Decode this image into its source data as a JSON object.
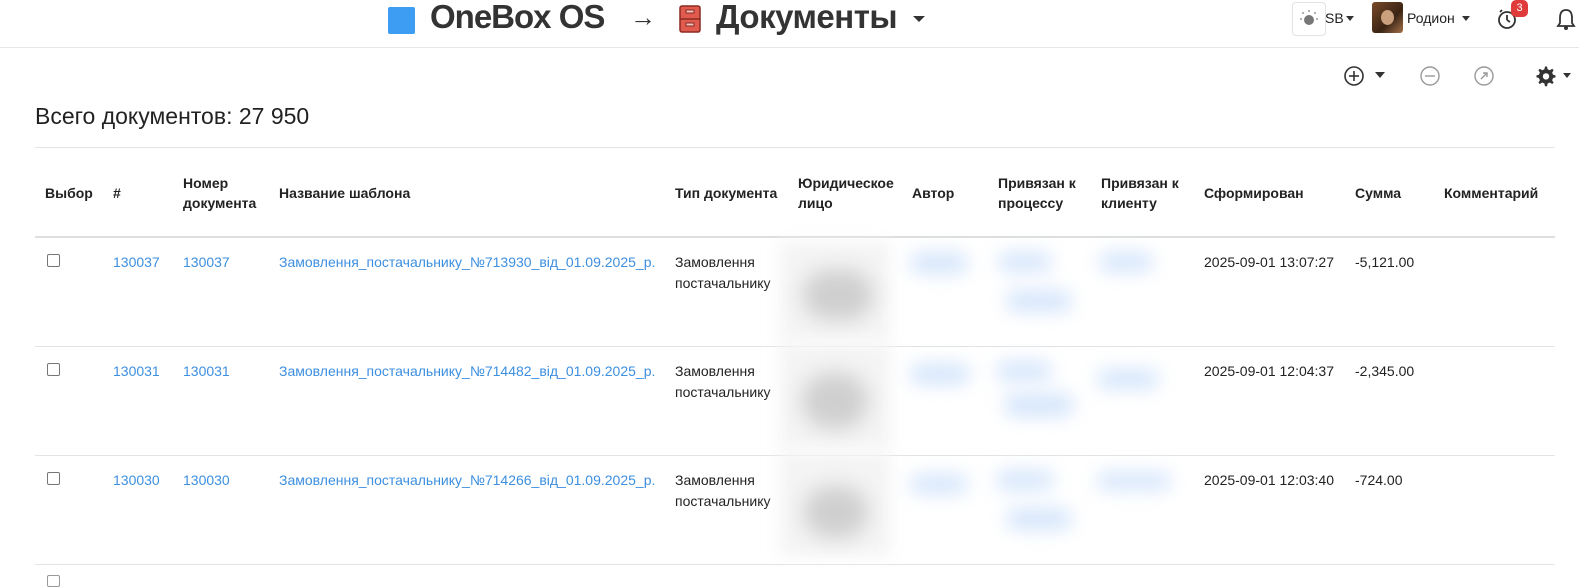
{
  "header": {
    "brand": "OneBox OS",
    "arrow": "→",
    "section": "Документы",
    "account": "SB",
    "user": "Родион",
    "notifications": "3"
  },
  "toolbar": {
    "icons": [
      "add-circle-icon",
      "minus-circle-icon",
      "arrow-circle-icon",
      "gear-icon"
    ]
  },
  "summary": {
    "label": "Всего документов: 27 950"
  },
  "table": {
    "columns": [
      "Выбор",
      "#",
      "Номер документа",
      "Название шаблона",
      "Тип документа",
      "Юридическое лицо",
      "Автор",
      "Привязан к процессу",
      "Привязан к клиенту",
      "Сформирован",
      "Сумма",
      "Комментарий"
    ],
    "rows": [
      {
        "id": "130037",
        "number": "130037",
        "template": "Замовлення_постачальнику_№713930_від_01.09.2025_р.",
        "type": "Замовлення постачальнику",
        "created": "2025-09-01 13:07:27",
        "sum": "-5,121.00",
        "comment": ""
      },
      {
        "id": "130031",
        "number": "130031",
        "template": "Замовлення_постачальнику_№714482_від_01.09.2025_р.",
        "type": "Замовлення постачальнику",
        "created": "2025-09-01 12:04:37",
        "sum": "-2,345.00",
        "comment": ""
      },
      {
        "id": "130030",
        "number": "130030",
        "template": "Замовлення_постачальнику_№714266_від_01.09.2025_р.",
        "type": "Замовлення постачальнику",
        "created": "2025-09-01 12:03:40",
        "sum": "-724.00",
        "comment": ""
      }
    ]
  },
  "colors": {
    "accent": "#3d9df2",
    "link": "#3d8fe0",
    "badge": "#e03b3b"
  }
}
